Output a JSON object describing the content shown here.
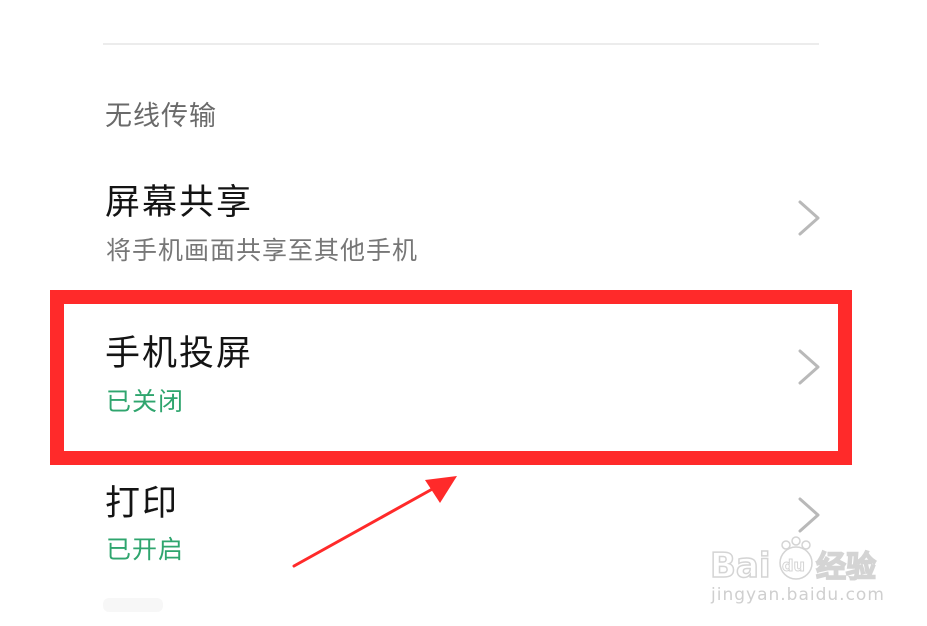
{
  "section": {
    "header": "无线传输"
  },
  "items": [
    {
      "title": "屏幕共享",
      "subtitle": "将手机画面共享至其他手机",
      "subtitle_color": "#777777",
      "chevron_icon": "chevron-right-icon"
    },
    {
      "title": "手机投屏",
      "subtitle": "已关闭",
      "subtitle_color": "#2fa56e",
      "chevron_icon": "chevron-right-icon"
    },
    {
      "title": "打印",
      "subtitle": "已开启",
      "subtitle_color": "#2fa56e",
      "chevron_icon": "chevron-right-icon"
    }
  ],
  "annotation": {
    "highlight_color": "#ff2a2a",
    "arrow_color": "#ff2a2a"
  },
  "watermark": {
    "brand": "Baidu经验",
    "url": "jingyan.baidu.com"
  }
}
